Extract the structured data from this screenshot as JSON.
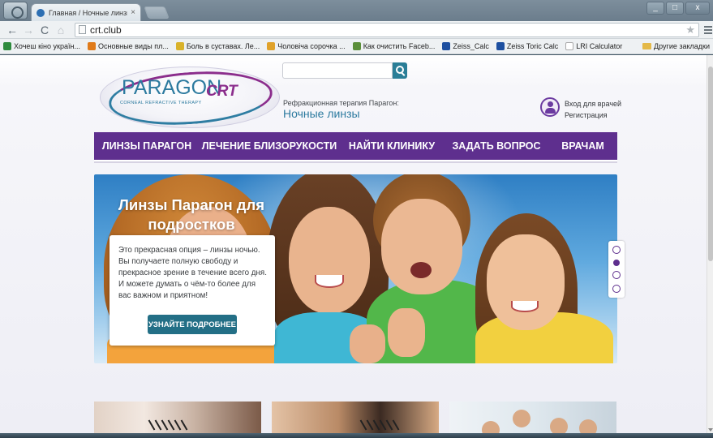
{
  "browser": {
    "tab_title": "Главная / Ночные линзы",
    "tab_close": "×",
    "url": "crt.club",
    "window_buttons": [
      "_",
      "□",
      "x"
    ],
    "bookmarks": [
      {
        "label": "Хочеш кіно україн...",
        "icon_color": "#2e8b3d"
      },
      {
        "label": "Основные виды пл...",
        "icon_color": "#e07b1a"
      },
      {
        "label": "Боль в суставах. Ле...",
        "icon_color": "#d9b22a"
      },
      {
        "label": "Чоловіча сорочка ...",
        "icon_color": "#e0a22a"
      },
      {
        "label": "Как очистить Faceb...",
        "icon_color": "#5b8f3a"
      },
      {
        "label": "Zeiss_Calc",
        "icon_color": "#1d4fa0"
      },
      {
        "label": "Zeiss Toric Calc",
        "icon_color": "#1d4fa0"
      },
      {
        "label": "LRI Calculator",
        "icon_color": "#ffffff"
      }
    ],
    "other_bookmarks": "Другие закладки"
  },
  "header": {
    "logo_paragon": "PARAGON",
    "logo_crt": "CRT",
    "logo_sub": "CORNEAL REFRACTIVE THERAPY",
    "search_placeholder": "",
    "tagline_small": "Рефракционная терапия Парагон:",
    "tagline_big": "Ночные линзы",
    "doctor_login": "Вход для врачей",
    "register": "Регистрация"
  },
  "nav": {
    "items": [
      "ЛИНЗЫ ПАРАГОН",
      "ЛЕЧЕНИЕ БЛИЗОРУКОСТИ",
      "НАЙТИ КЛИНИКУ",
      "ЗАДАТЬ ВОПРОС",
      "ВРАЧАМ"
    ],
    "color": "#5e2f8e"
  },
  "hero": {
    "title": "Линзы Парагон для подростков",
    "text": "Это прекрасная опция – линзы ночью. Вы получаете полную свободу и прекрасное зрение в течение всего дня. И можете думать о чём-то более для вас важном и приятном!",
    "button": "УЗНАЙТЕ ПОДРОБНЕЕ",
    "slides_count": 4,
    "active_slide": 2
  },
  "colors": {
    "accent_teal": "#2c7a9f",
    "accent_purple": "#8b2d8c",
    "button_teal": "#236f86"
  }
}
